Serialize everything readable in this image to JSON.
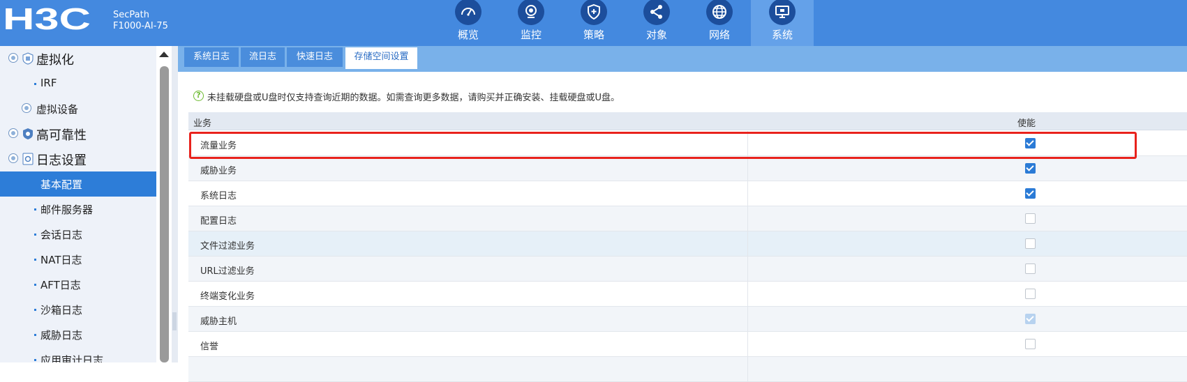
{
  "header": {
    "logo_text": "H3C",
    "product_line1": "SecPath",
    "product_line2": "F1000-AI-75",
    "nav": [
      {
        "label": "概览",
        "icon": "gauge-icon"
      },
      {
        "label": "监控",
        "icon": "camera-icon"
      },
      {
        "label": "策略",
        "icon": "shield-plus-icon"
      },
      {
        "label": "对象",
        "icon": "share-nodes-icon"
      },
      {
        "label": "网络",
        "icon": "globe-icon"
      },
      {
        "label": "系统",
        "icon": "monitor-icon",
        "active": true
      }
    ]
  },
  "sidebar": {
    "items": [
      {
        "label": "虚拟化",
        "level": 1
      },
      {
        "label": "IRF",
        "level": 3
      },
      {
        "label": "虚拟设备",
        "level": 2
      },
      {
        "label": "高可靠性",
        "level": 1
      },
      {
        "label": "日志设置",
        "level": 1
      },
      {
        "label": "基本配置",
        "level": 3,
        "selected": true
      },
      {
        "label": "邮件服务器",
        "level": 3
      },
      {
        "label": "会话日志",
        "level": 3
      },
      {
        "label": "NAT日志",
        "level": 3
      },
      {
        "label": "AFT日志",
        "level": 3
      },
      {
        "label": "沙箱日志",
        "level": 3
      },
      {
        "label": "威胁日志",
        "level": 3
      },
      {
        "label": "应用审计日志",
        "level": 3
      }
    ]
  },
  "tabs": [
    {
      "label": "系统日志"
    },
    {
      "label": "流日志"
    },
    {
      "label": "快速日志"
    },
    {
      "label": "存储空间设置",
      "active": true
    }
  ],
  "notice": "未挂载硬盘或U盘时仅支持查询近期的数据。如需查询更多数据，请购买并正确安装、挂载硬盘或U盘。",
  "table": {
    "columns": [
      "业务",
      "使能"
    ],
    "rows": [
      {
        "name": "流量业务",
        "enabled": "checked"
      },
      {
        "name": "威胁业务",
        "enabled": "checked"
      },
      {
        "name": "系统日志",
        "enabled": "checked"
      },
      {
        "name": "配置日志",
        "enabled": "unchecked"
      },
      {
        "name": "文件过滤业务",
        "enabled": "unchecked"
      },
      {
        "name": "URL过滤业务",
        "enabled": "unchecked"
      },
      {
        "name": "终端变化业务",
        "enabled": "unchecked"
      },
      {
        "name": "威胁主机",
        "enabled": "checked-disabled"
      },
      {
        "name": "信誉",
        "enabled": "unchecked"
      }
    ]
  },
  "colors": {
    "header_bg": "#4489df",
    "accent": "#2d7dd8",
    "highlight": "#e8221c"
  }
}
